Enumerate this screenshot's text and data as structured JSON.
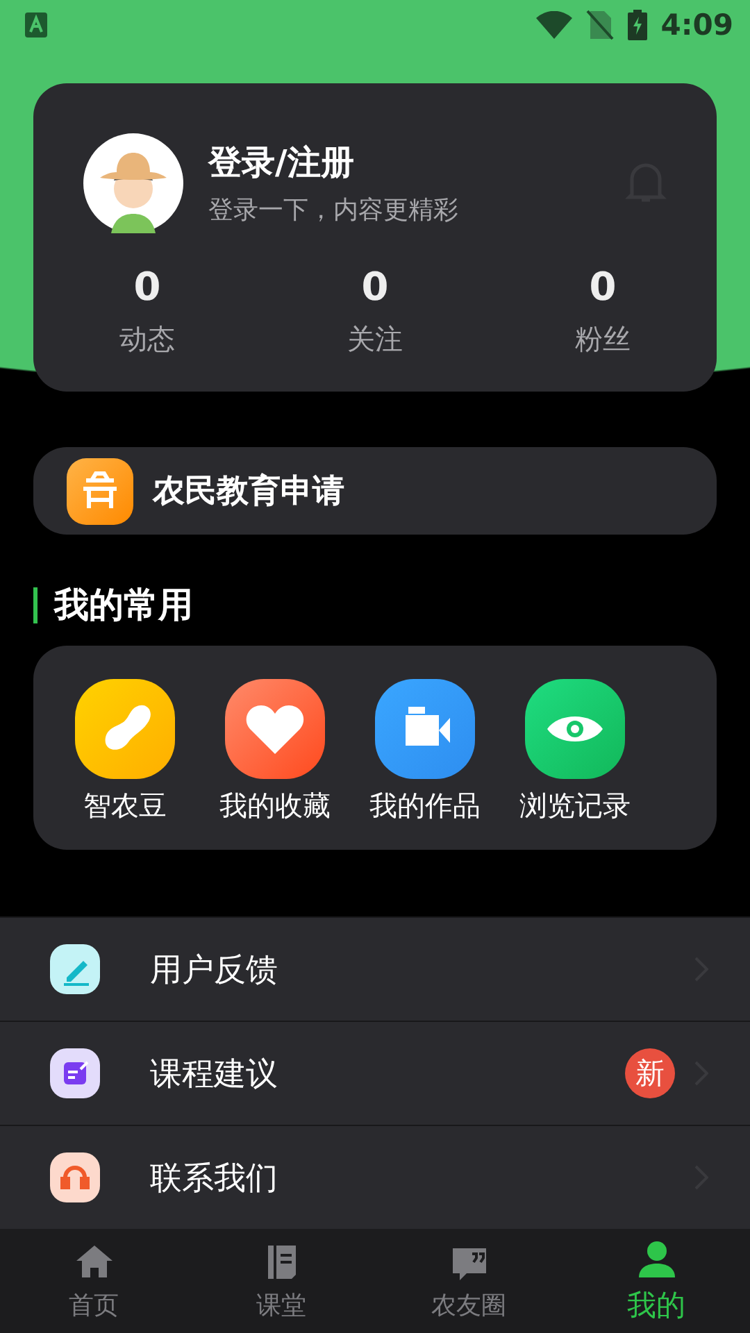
{
  "status_bar": {
    "time": "4:09"
  },
  "profile": {
    "title": "登录/注册",
    "subtitle": "登录一下，内容更精彩",
    "stats": [
      {
        "value": "0",
        "label": "动态"
      },
      {
        "value": "0",
        "label": "关注"
      },
      {
        "value": "0",
        "label": "粉丝"
      }
    ]
  },
  "education": {
    "label": "农民教育申请"
  },
  "section_title": "我的常用",
  "shortcuts": [
    {
      "label": "智农豆",
      "kind": "bean"
    },
    {
      "label": "我的收藏",
      "kind": "heart"
    },
    {
      "label": "我的作品",
      "kind": "video"
    },
    {
      "label": "浏览记录",
      "kind": "eye"
    }
  ],
  "menu": [
    {
      "label": "用户反馈",
      "kind": "feedback"
    },
    {
      "label": "课程建议",
      "kind": "suggest",
      "badge": "新"
    },
    {
      "label": "联系我们",
      "kind": "contact"
    }
  ],
  "tabs": [
    {
      "label": "首页",
      "kind": "home",
      "selected": false
    },
    {
      "label": "课堂",
      "kind": "book",
      "selected": false
    },
    {
      "label": "农友圈",
      "kind": "chat",
      "selected": false
    },
    {
      "label": "我的",
      "kind": "user",
      "selected": true
    }
  ]
}
